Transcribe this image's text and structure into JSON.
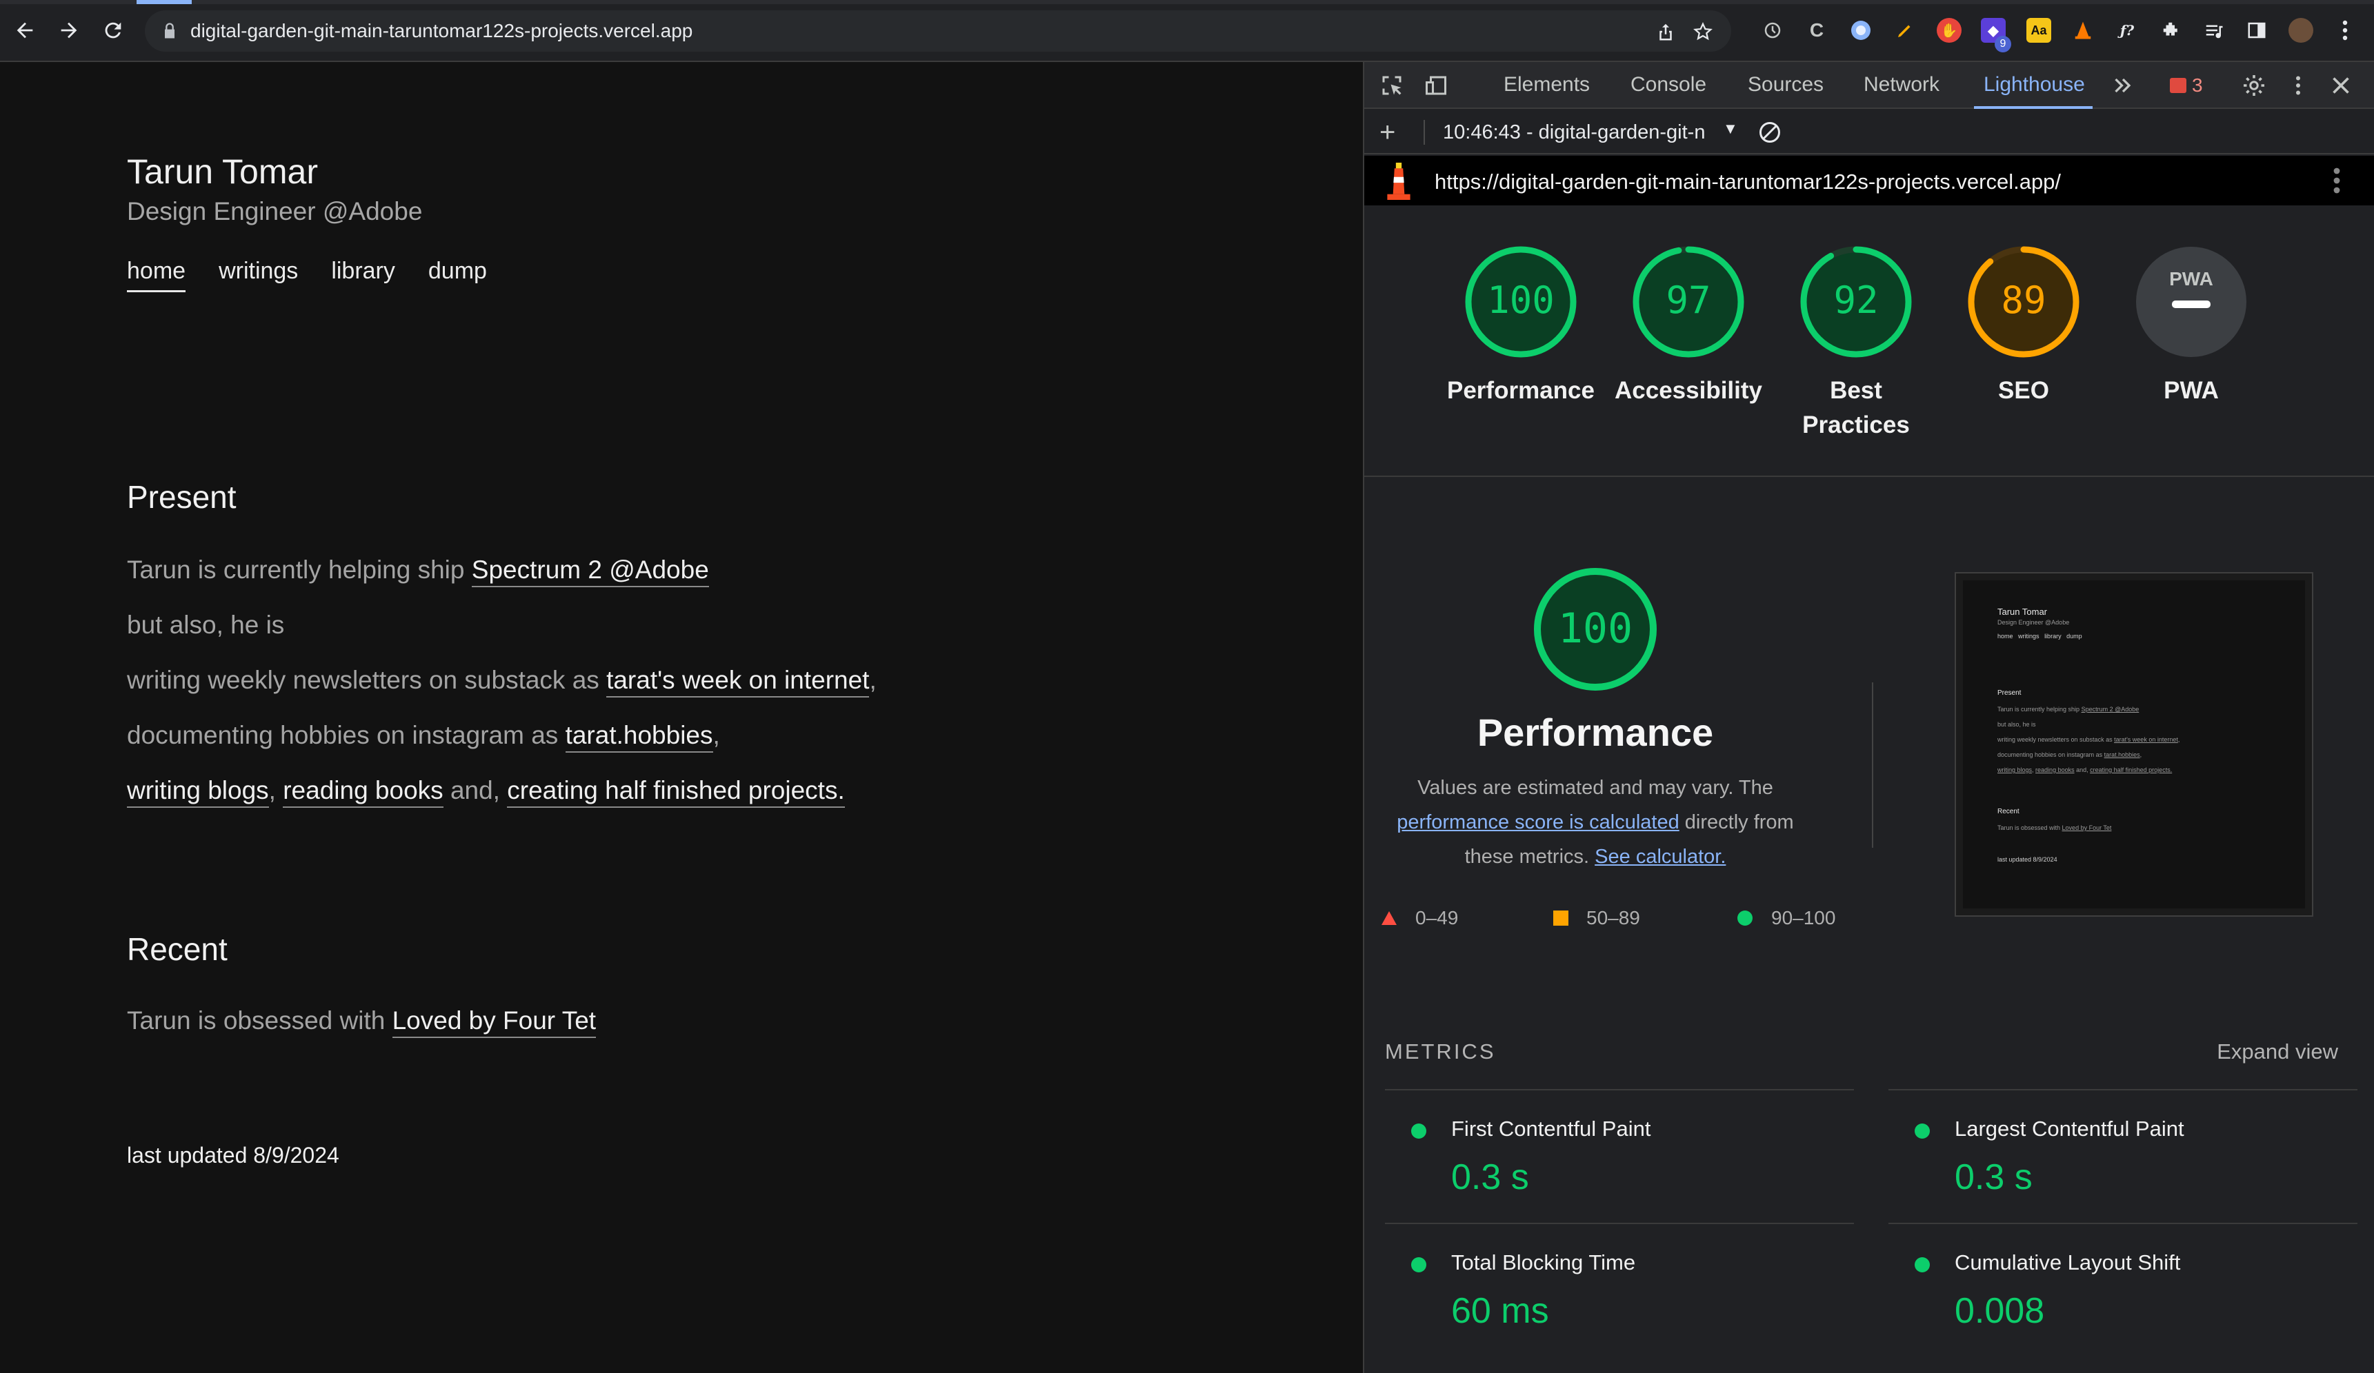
{
  "browser": {
    "url": "digital-garden-git-main-taruntomar122s-projects.vercel.app",
    "extension_badge": "9"
  },
  "site": {
    "name": "Tarun Tomar",
    "subtitle": "Design Engineer @Adobe",
    "nav": [
      "home",
      "writings",
      "library",
      "dump"
    ],
    "present": {
      "heading": "Present",
      "line1_text": "Tarun is currently helping ship ",
      "line1_link": "Spectrum 2 @Adobe",
      "line2_text": "but also, he is",
      "line3_text": "writing weekly newsletters on substack as ",
      "line3_link": "tarat's week on internet",
      "line3_after": ",",
      "line4_text": "documenting hobbies on instagram as ",
      "line4_link": "tarat.hobbies",
      "line4_after": ",",
      "line5_link1": "writing blogs",
      "line5_sep1": ", ",
      "line5_link2": "reading books",
      "line5_sep2": " and, ",
      "line5_link3": "creating half finished projects."
    },
    "recent": {
      "heading": "Recent",
      "text": "Tarun is obsessed with ",
      "link": "Loved by Four Tet"
    },
    "updated": "last updated 8/9/2024"
  },
  "devtools": {
    "tabs": [
      "Elements",
      "Console",
      "Sources",
      "Network",
      "Lighthouse"
    ],
    "active_tab": "Lighthouse",
    "error_count": "3",
    "report_label": "10:46:43 - digital-garden-git-n",
    "report_url": "https://digital-garden-git-main-taruntomar122s-projects.vercel.app/"
  },
  "scores": [
    {
      "label": "Performance",
      "value": 100,
      "color": "#0cce6b"
    },
    {
      "label": "Accessibility",
      "value": 97,
      "color": "#0cce6b"
    },
    {
      "label": "Best Practices",
      "value": 92,
      "color": "#0cce6b"
    },
    {
      "label": "SEO",
      "value": 89,
      "color": "#ffa400"
    },
    {
      "label": "PWA",
      "value": null,
      "badge": "PWA",
      "color": "#9aa0a6"
    }
  ],
  "performance": {
    "score": "100",
    "title": "Performance",
    "desc_before": "Values are estimated and may vary. The ",
    "desc_link1": "performance score is calculated",
    "desc_mid": " directly from these metrics. ",
    "desc_link2": "See calculator.",
    "legend": [
      "0–49",
      "50–89",
      "90–100"
    ]
  },
  "metrics": {
    "heading": "METRICS",
    "expand": "Expand view",
    "items": [
      {
        "name": "First Contentful Paint",
        "value": "0.3 s"
      },
      {
        "name": "Largest Contentful Paint",
        "value": "0.3 s"
      },
      {
        "name": "Total Blocking Time",
        "value": "60 ms"
      },
      {
        "name": "Cumulative Layout Shift",
        "value": "0.008"
      }
    ]
  },
  "colors": {
    "pass": "#0cce6b",
    "average": "#ffa400",
    "fail": "#ff4e42",
    "link": "#8ab4f8"
  }
}
